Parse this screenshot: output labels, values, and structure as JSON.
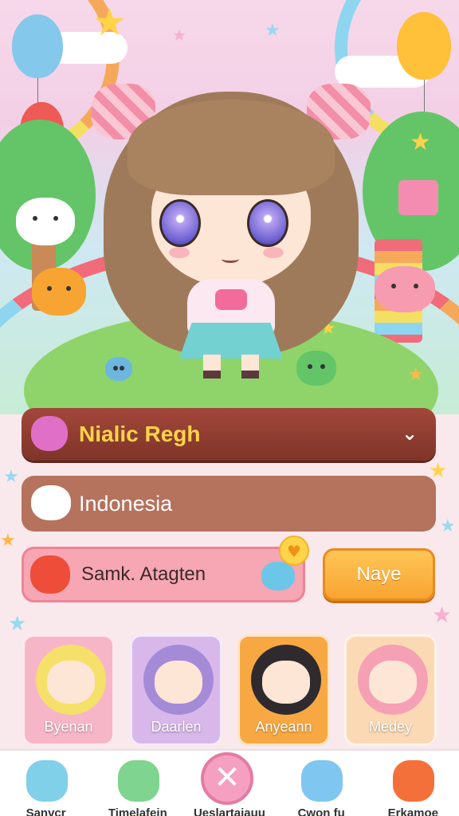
{
  "profile": {
    "name": "Nialic Regh",
    "country": "Indonesia",
    "input_text": "Samk. Atagten",
    "name_button": "Naye"
  },
  "characters": [
    {
      "name": "Byenan",
      "bg": "#f7b6c8",
      "hair": "#f5e06a"
    },
    {
      "name": "Daarlen",
      "bg": "#d8b8ea",
      "hair": "#a58ad8"
    },
    {
      "name": "Anyeann",
      "bg": "#f8a842",
      "hair": "#2f2a2e"
    },
    {
      "name": "Medey",
      "bg": "#fbd9b4",
      "hair": "#f5a0b4"
    }
  ],
  "nav": [
    {
      "label": "Sanvcr",
      "icon": "backpack-icon",
      "color": "#7fd0e8"
    },
    {
      "label": "Timelafein",
      "icon": "monster-icon",
      "color": "#7fd48f"
    },
    {
      "label": "Ueslartaiauu",
      "icon": "close-icon",
      "color": "#f5a0c0"
    },
    {
      "label": "Cwon fu",
      "icon": "watering-can-icon",
      "color": "#7fc6f0"
    },
    {
      "label": "Erkamoe",
      "icon": "bear-icon",
      "color": "#f4703a"
    }
  ],
  "colors": {
    "name_text": "#ffd44a",
    "name_bar": "#8d3a2e",
    "country_bar": "#b5725c",
    "input_bg": "#f7a6b3",
    "button": "#f8a432"
  }
}
